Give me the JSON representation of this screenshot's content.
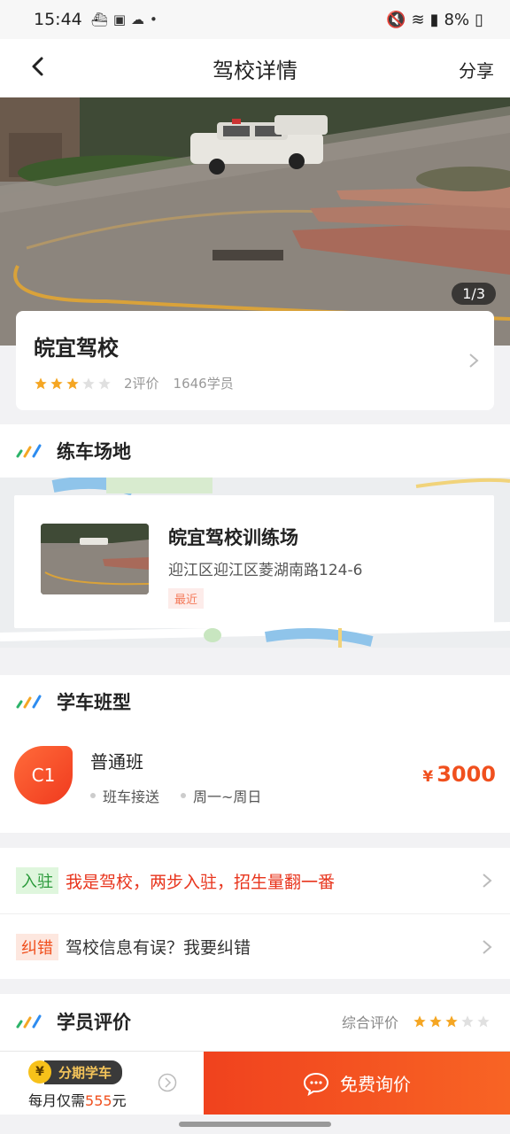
{
  "status_bar": {
    "time": "15:44",
    "battery": "8%"
  },
  "nav": {
    "title": "驾校详情",
    "share": "分享"
  },
  "hero": {
    "counter": "1/3"
  },
  "school": {
    "name": "皖宜驾校",
    "rating": 3,
    "rating_max": 5,
    "reviews": "2评价",
    "students": "1646学员"
  },
  "venue_section": {
    "title": "练车场地",
    "name": "皖宜驾校训练场",
    "address": "迎江区迎江区菱湖南路124-6",
    "tag": "最近"
  },
  "class_section": {
    "title": "学车班型",
    "items": [
      {
        "badge": "C1",
        "name": "普通班",
        "features": [
          "班车接送",
          "周一~周日"
        ],
        "currency": "¥",
        "price": "3000"
      }
    ]
  },
  "links": [
    {
      "label": "入驻",
      "text": "我是驾校，两步入驻，招生量翻一番"
    },
    {
      "label": "纠错",
      "text": "驾校信息有误？我要纠错"
    }
  ],
  "review_section": {
    "title": "学员评价",
    "overall_label": "综合评价",
    "rating": 3
  },
  "bottom_bar": {
    "coin": "¥",
    "installment": "分期学车",
    "monthly_prefix": "每月仅需",
    "monthly_amount": "555",
    "monthly_suffix": "元",
    "inquire": "免费询价"
  },
  "colors": {
    "accent": "#f0501e",
    "star": "#f5a623",
    "star_empty": "#e0e0e0"
  }
}
